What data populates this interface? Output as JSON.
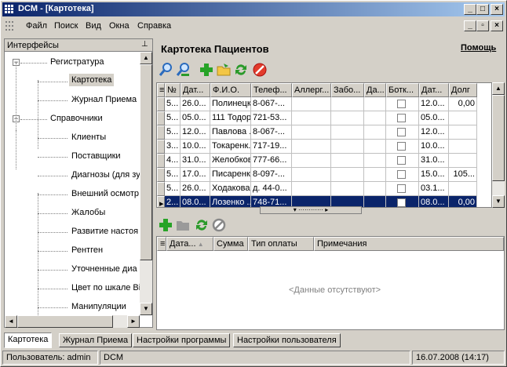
{
  "window": {
    "title": "DCM - [Картотека]"
  },
  "menu": {
    "file": "Файл",
    "search": "Поиск",
    "view": "Вид",
    "windows": "Окна",
    "help": "Справка"
  },
  "left_panel": {
    "title": "Интерфейсы",
    "pin_icon": "pin-icon",
    "tree": [
      {
        "label": "Регистратура",
        "level": 0,
        "expanded": true
      },
      {
        "label": "Картотека",
        "level": 1,
        "selected": true
      },
      {
        "label": "Журнал Приема",
        "level": 1
      },
      {
        "label": "Справочники",
        "level": 0,
        "expanded": true
      },
      {
        "label": "Клиенты",
        "level": 1
      },
      {
        "label": "Поставщики",
        "level": 1
      },
      {
        "label": "Диагнозы (для зу",
        "level": 1
      },
      {
        "label": "Внешний осмотр",
        "level": 1
      },
      {
        "label": "Жалобы",
        "level": 1
      },
      {
        "label": "Развитие настоя",
        "level": 1
      },
      {
        "label": "Рентген",
        "level": 1
      },
      {
        "label": "Уточненные диа",
        "level": 1
      },
      {
        "label": "Цвет по шкале Ві",
        "level": 1
      },
      {
        "label": "Манипуляции",
        "level": 1
      }
    ]
  },
  "main": {
    "heading": "Картотека Пациентов",
    "help_link": "Помощь",
    "toolbar_icons": [
      "search-icon",
      "user-search-icon",
      "add-icon",
      "open-folder-icon",
      "refresh-icon",
      "delete-icon"
    ],
    "patients": {
      "columns": [
        "№",
        "Дат...",
        "Ф.И.О.",
        "Телеф...",
        "Аллерг...",
        "Забо...",
        "Да...",
        "Ботк...",
        "Дат...",
        "Долг"
      ],
      "rows": [
        [
          "5...",
          "26.0...",
          "Полинецк...",
          "8-067-...",
          "",
          "",
          "",
          "",
          "12.0...",
          "0,00"
        ],
        [
          "5...",
          "05.0...",
          "111 Тодор...",
          "721-53...",
          "",
          "",
          "",
          "",
          "05.0...",
          ""
        ],
        [
          "5...",
          "12.0...",
          "Павлова ...",
          "8-067-...",
          "",
          "",
          "",
          "",
          "12.0...",
          ""
        ],
        [
          "3...",
          "10.0...",
          "Токаренк...",
          "717-19...",
          "",
          "",
          "",
          "",
          "10.0...",
          ""
        ],
        [
          "4...",
          "31.0...",
          "Желобков...",
          "777-66...",
          "",
          "",
          "",
          "",
          "31.0...",
          ""
        ],
        [
          "5...",
          "17.0...",
          "Писаренк...",
          "8-097-...",
          "",
          "",
          "",
          "",
          "15.0...",
          "105..."
        ],
        [
          "5...",
          "26.0...",
          "Ходакова ...",
          "д. 44-0...",
          "",
          "",
          "",
          "",
          "03.1...",
          ""
        ],
        [
          "2...",
          "08.0...",
          "Лозенко ...",
          "748-71...",
          "",
          "",
          "",
          "",
          "08.0...",
          "0,00"
        ]
      ],
      "active_row": 7
    },
    "payments_toolbar_icons": [
      "add-icon",
      "folder-icon",
      "refresh-icon",
      "cancel-icon"
    ],
    "payments": {
      "columns": [
        "Дата...",
        "Сумма",
        "Тип оплаты",
        "Примечания"
      ],
      "empty_text": "<Данные отсутствуют>"
    }
  },
  "tabs": [
    "Картотека",
    "Журнал Приема",
    "Настройки программы",
    "Настройки пользователя"
  ],
  "status": {
    "user": "Пользователь: admin",
    "app": "DCM",
    "datetime": "16.07.2008 (14:17)"
  }
}
